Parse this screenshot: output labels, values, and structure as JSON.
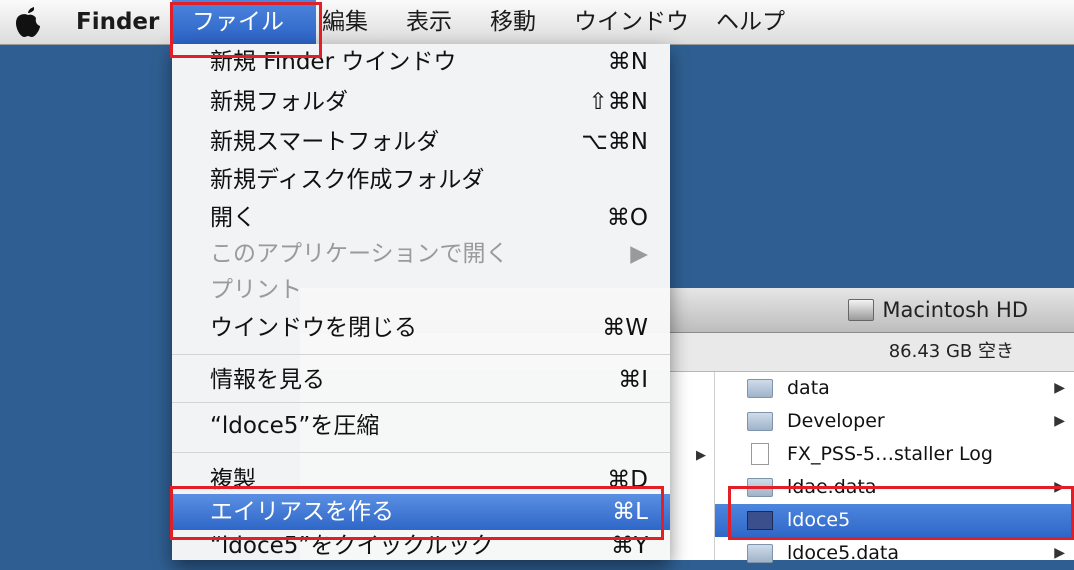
{
  "menubar": {
    "items": [
      "Finder",
      "ファイル",
      "編集",
      "表示",
      "移動",
      "ウインドウ",
      "ヘルプ"
    ]
  },
  "file_menu": {
    "items": [
      {
        "label": "新規 Finder ウインドウ",
        "shortcut": "⌘N"
      },
      {
        "label": "新規フォルダ",
        "shortcut": "⇧⌘N"
      },
      {
        "label": "新規スマートフォルダ",
        "shortcut": "⌥⌘N"
      },
      {
        "label": "新規ディスク作成フォルダ",
        "shortcut": ""
      },
      {
        "label": "開く",
        "shortcut": "⌘O"
      },
      {
        "label": "このアプリケーションで開く",
        "shortcut": "▶"
      },
      {
        "label": "プリント",
        "shortcut": ""
      },
      {
        "label": "ウインドウを閉じる",
        "shortcut": "⌘W"
      },
      {
        "label": "情報を見る",
        "shortcut": "⌘I"
      },
      {
        "label": "“ldoce5”を圧縮",
        "shortcut": ""
      },
      {
        "label": "複製",
        "shortcut": "⌘D"
      },
      {
        "label": "エイリアスを作る",
        "shortcut": "⌘L"
      },
      {
        "label": "“ldoce5”をクイックルック",
        "shortcut": "⌘Y"
      }
    ]
  },
  "finder_window": {
    "title": "Macintosh HD",
    "free_space": "86.43 GB 空き",
    "files": [
      {
        "name": "data",
        "icon": "folder-icon",
        "arrow": "▶"
      },
      {
        "name": "Developer",
        "icon": "folder-icon",
        "arrow": "▶"
      },
      {
        "name": "FX_PSS-5…staller Log",
        "icon": "document-icon",
        "arrow": ""
      },
      {
        "name": "ldae.data",
        "icon": "folder-icon",
        "arrow": "▶"
      },
      {
        "name": "ldoce5",
        "icon": "app-icon",
        "arrow": ""
      },
      {
        "name": "ldoce5.data",
        "icon": "folder-icon",
        "arrow": "▶"
      }
    ]
  },
  "colors": {
    "desktop": "#2f5f92",
    "selection": "#2f67c8",
    "annotation_red": "#e21f26"
  }
}
